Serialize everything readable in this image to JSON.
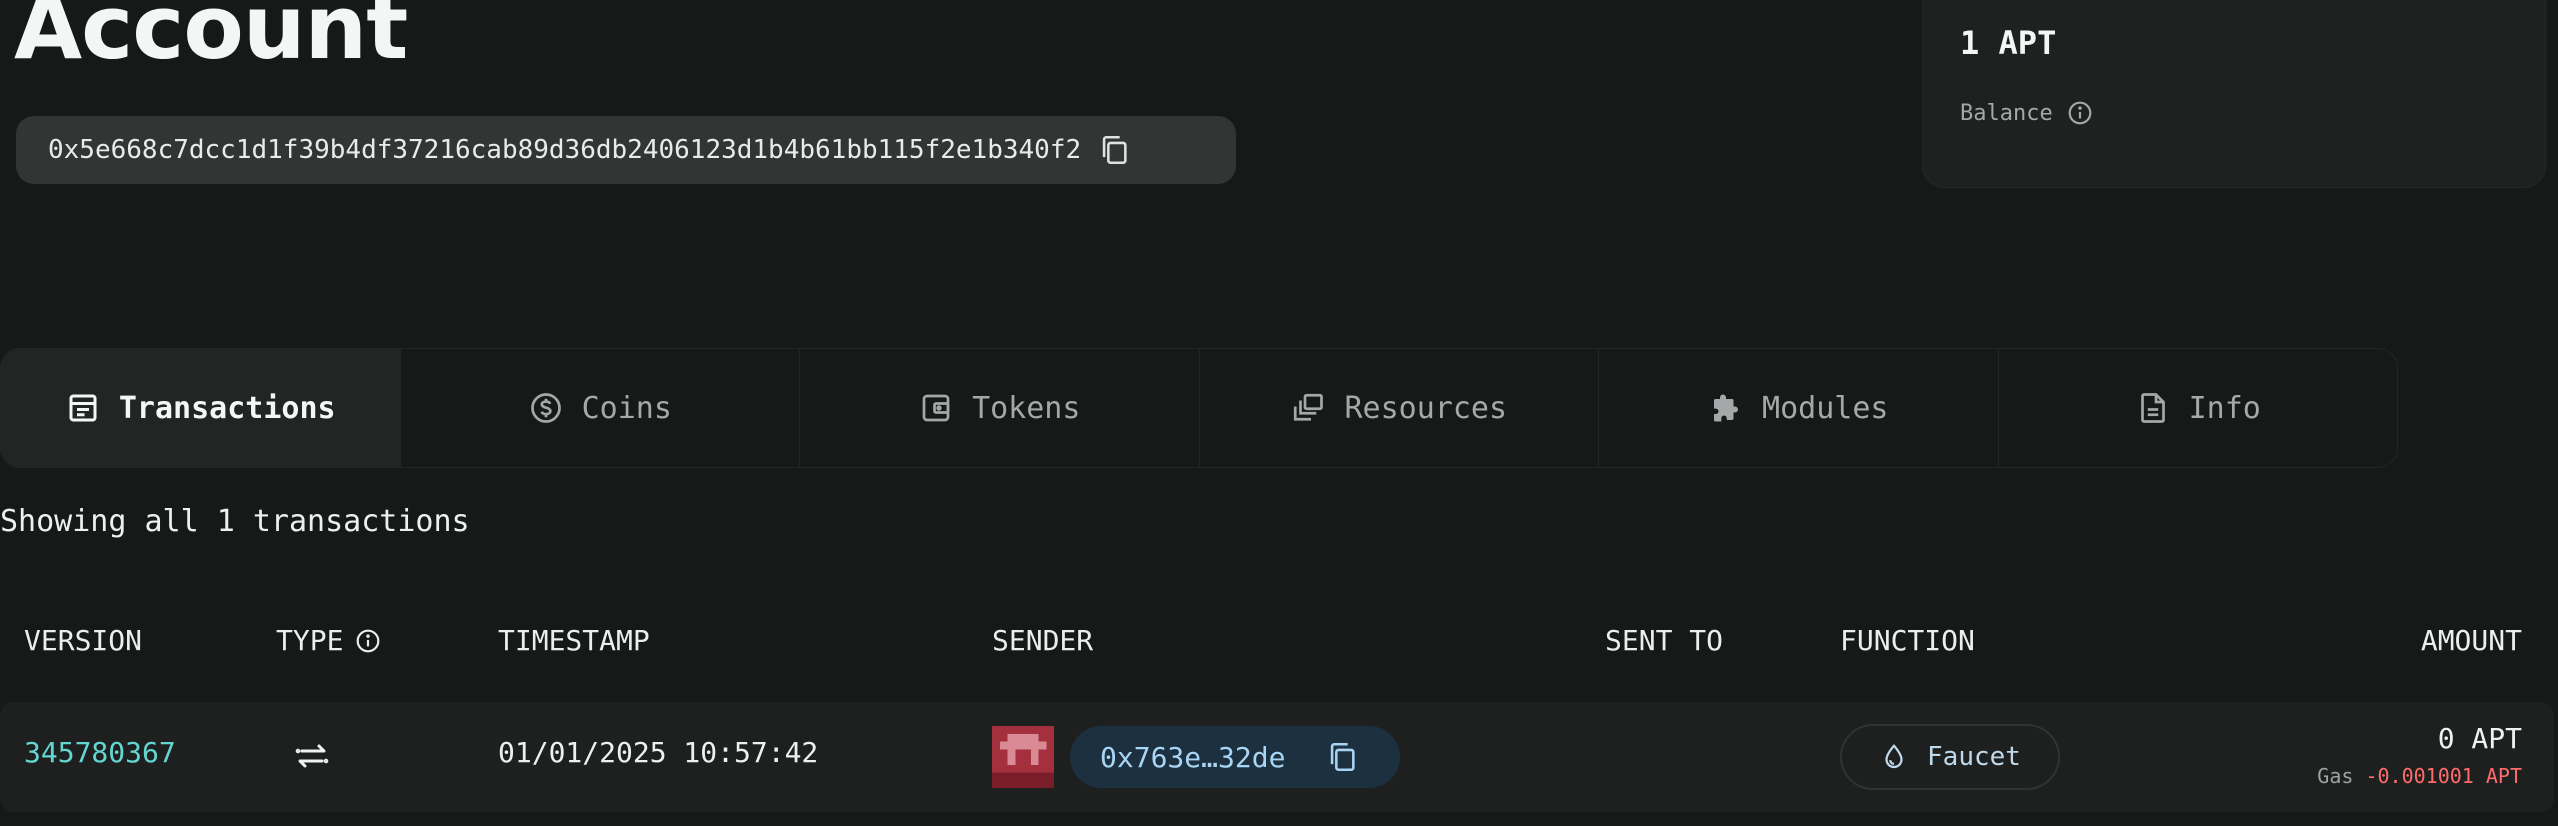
{
  "account": {
    "title": "Account",
    "address": "0x5e668c7dcc1d1f39b4df37216cab89d36db2406123d1b4b61bb115f2e1b340f2"
  },
  "balance": {
    "value": "1 APT",
    "label": "Balance"
  },
  "tabs": [
    {
      "label": "Transactions",
      "icon": "transactions-icon",
      "active": true
    },
    {
      "label": "Coins",
      "icon": "coin-icon"
    },
    {
      "label": "Tokens",
      "icon": "wallet-icon"
    },
    {
      "label": "Resources",
      "icon": "resources-icon"
    },
    {
      "label": "Modules",
      "icon": "puzzle-icon"
    },
    {
      "label": "Info",
      "icon": "document-icon"
    }
  ],
  "showing": "Showing all 1 transactions",
  "table": {
    "headers": {
      "version": "VERSION",
      "type": "TYPE",
      "timestamp": "TIMESTAMP",
      "sender": "SENDER",
      "sent_to": "SENT TO",
      "function": "FUNCTION",
      "amount": "AMOUNT"
    },
    "rows": [
      {
        "version": "345780367",
        "type_icon": "transfer-arrows-icon",
        "timestamp": "01/01/2025 10:57:42",
        "sender": "0x763e…32de",
        "sent_to": "",
        "function": "Faucet",
        "amount": "0 APT",
        "gas_label": "Gas",
        "gas_value": "-0.001001 APT"
      }
    ]
  },
  "colors": {
    "background": "#171818",
    "link": "#63d6d0",
    "negative": "#ff6b6b",
    "sender_pill": "#1c3040",
    "avatar": "#a3303c"
  }
}
